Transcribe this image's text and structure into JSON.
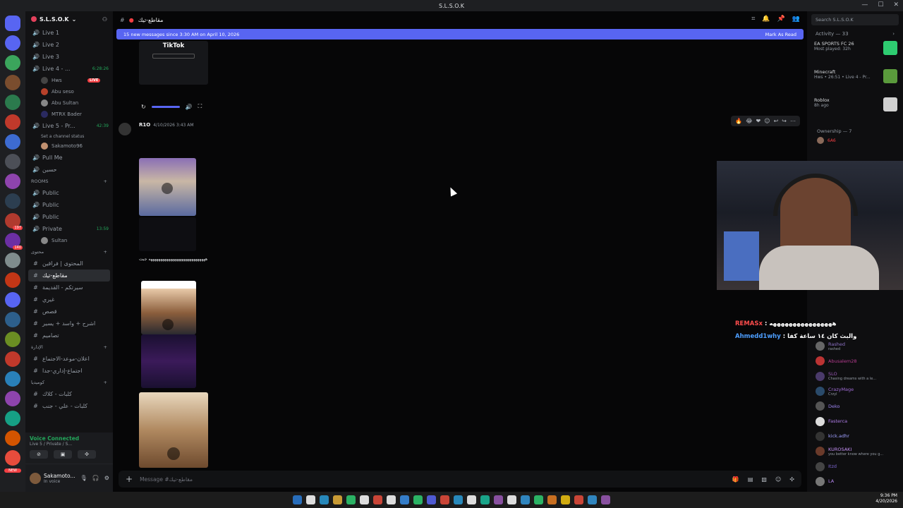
{
  "window": {
    "title": "S.L.S.O.K"
  },
  "server_rail": {
    "items": [
      {
        "color": "#5865f2",
        "badge": ""
      },
      {
        "color": "#3ba55c",
        "badge": ""
      },
      {
        "color": "#7a4d2e",
        "badge": ""
      },
      {
        "color": "#2b7a4d",
        "badge": ""
      },
      {
        "color": "#c0392b",
        "badge": ""
      },
      {
        "color": "#3d6bd1",
        "badge": ""
      },
      {
        "color": "#4c4f57",
        "badge": ""
      },
      {
        "color": "#8e44ad",
        "badge": ""
      },
      {
        "color": "#2c3e50",
        "badge": ""
      },
      {
        "color": "#b03a2e",
        "badge": "197"
      },
      {
        "color": "#6b2fa3",
        "badge": "140"
      },
      {
        "color": "#7f8c8d",
        "badge": ""
      },
      {
        "color": "#c23616",
        "badge": ""
      },
      {
        "color": "#5865f2",
        "badge": ""
      },
      {
        "color": "#2d5f8b",
        "badge": ""
      },
      {
        "color": "#6b8e23",
        "badge": ""
      },
      {
        "color": "#c0392b",
        "badge": ""
      },
      {
        "color": "#2980b9",
        "badge": ""
      },
      {
        "color": "#8e44ad",
        "badge": ""
      },
      {
        "color": "#16a085",
        "badge": ""
      },
      {
        "color": "#d35400",
        "badge": ""
      },
      {
        "color": "#e74c3c",
        "badge": ""
      }
    ],
    "new_badge": "NEW"
  },
  "sidebar": {
    "server_name": "S.L.S.O.K",
    "voice_channels": [
      {
        "label": "Live 1",
        "timer": ""
      },
      {
        "label": "Live 2",
        "timer": ""
      },
      {
        "label": "Live 3",
        "timer": ""
      },
      {
        "label": "Live 4 - ...",
        "timer": "6:28:26"
      }
    ],
    "live4_users": [
      {
        "name": "Hws",
        "live": "LIVE"
      },
      {
        "name": "Abu seso",
        "live": ""
      },
      {
        "name": "Abu Sultan",
        "live": ""
      },
      {
        "name": "MTRX Bader",
        "live": ""
      }
    ],
    "live5": {
      "label": "Live 5 - Pr...",
      "timer": "42:39",
      "status": "Set a channel status",
      "user": "Sakamoto96"
    },
    "pull_me": "Pull Me",
    "emoji_channel": "حسين",
    "rooms_category": "ROOMS",
    "rooms": [
      {
        "label": "Public",
        "timer": ""
      },
      {
        "label": "Public",
        "timer": ""
      },
      {
        "label": "Public",
        "timer": ""
      },
      {
        "label": "Private",
        "timer": "13:59"
      }
    ],
    "private_user": "Sultan",
    "category2": "محتوى",
    "text_channels": [
      {
        "label": "المحتوى | فراقين",
        "selected": false
      },
      {
        "label": "مقاطع-تيك",
        "selected": true
      },
      {
        "label": "سيرتكم - القديمة",
        "selected": false
      },
      {
        "label": "غيري",
        "selected": false
      },
      {
        "label": "قصص",
        "selected": false
      },
      {
        "label": "اشرح + واسد + يسير",
        "selected": false
      },
      {
        "label": "تصاميم",
        "selected": false
      }
    ],
    "category3": "الإدارة",
    "admin_channels": [
      "اعلان-موعد-الاجتماع",
      "اجتماع-إداري-جدا"
    ],
    "category4": "كوميديا",
    "bottom_channels": [
      "كلبات - كلاك",
      "كلبات - علي - جنب"
    ]
  },
  "voice_status": {
    "title": "Voice Connected",
    "subtitle": "Live 5 / Private / S..."
  },
  "user": {
    "name": "Sakamoto...",
    "status": "In voice"
  },
  "channel": {
    "name": "مقاطع-تيك"
  },
  "new_messages": {
    "text": "15 new messages since 3:30 AM on April 10, 2026",
    "action": "Mark As Read"
  },
  "embed_tiktok": {
    "label": "TikTok"
  },
  "message": {
    "author": "R1O",
    "timestamp": "4/10/2026 3:43 AM",
    "caption": "هههههههههههههههههههههههههههههه جبت"
  },
  "reactions": [
    "🔥",
    "😂",
    "❤"
  ],
  "composer": {
    "placeholder": "Message #مقاطع-تيك"
  },
  "search": {
    "placeholder": "Search S.L.S.O.K"
  },
  "activity": {
    "header": "Activity — 33",
    "cards": [
      {
        "title": "EA SPORTS FC 26",
        "sub": "Most played: 32h",
        "color": "#2ecc71"
      },
      {
        "title": "Minecraft",
        "sub": "Hws • 26:51 • Live 4 - Pr...",
        "color": "#5a9a3c"
      },
      {
        "title": "Roblox",
        "sub": "8h ago",
        "color": "#d0d0d0"
      }
    ],
    "ownership": "Ownership — 7",
    "ownership_member": {
      "name": "6A6",
      "color": "#f23f43"
    }
  },
  "members": [
    {
      "name": "Rashed",
      "sub": "rashed",
      "color": "#8e72c7"
    },
    {
      "name": "Abusalem28",
      "sub": "",
      "color": "#b53b8f"
    },
    {
      "name": "SLO",
      "sub": "Chasing dreams with a le...",
      "color": "#9b59b6"
    },
    {
      "name": "CrazyMage",
      "sub": "Crzyl",
      "color": "#a06cd5"
    },
    {
      "name": "Deko",
      "sub": "",
      "color": "#9c84ef"
    },
    {
      "name": "Fasterca",
      "sub": "",
      "color": "#b07de8"
    },
    {
      "name": "kick.adhr",
      "sub": "",
      "color": "#a0a0ff"
    },
    {
      "name": "KUROSAKI",
      "sub": "you better know where you g...",
      "color": "#c38ef2"
    },
    {
      "name": "Itzd",
      "sub": "",
      "color": "#7d67d1"
    },
    {
      "name": "LA",
      "sub": "",
      "color": "#b586f0"
    }
  ],
  "stream_chat": [
    {
      "user": "REMASx",
      "text": "ههههههههههههههههه",
      "color": "#ff4d4d"
    },
    {
      "user": "Ahmedd1why",
      "text": "والبث كان ١٤ ساعة كفا",
      "color": "#4d9eff"
    }
  ],
  "taskbar": {
    "time": "9:36 PM",
    "date": "4/20/2026"
  }
}
